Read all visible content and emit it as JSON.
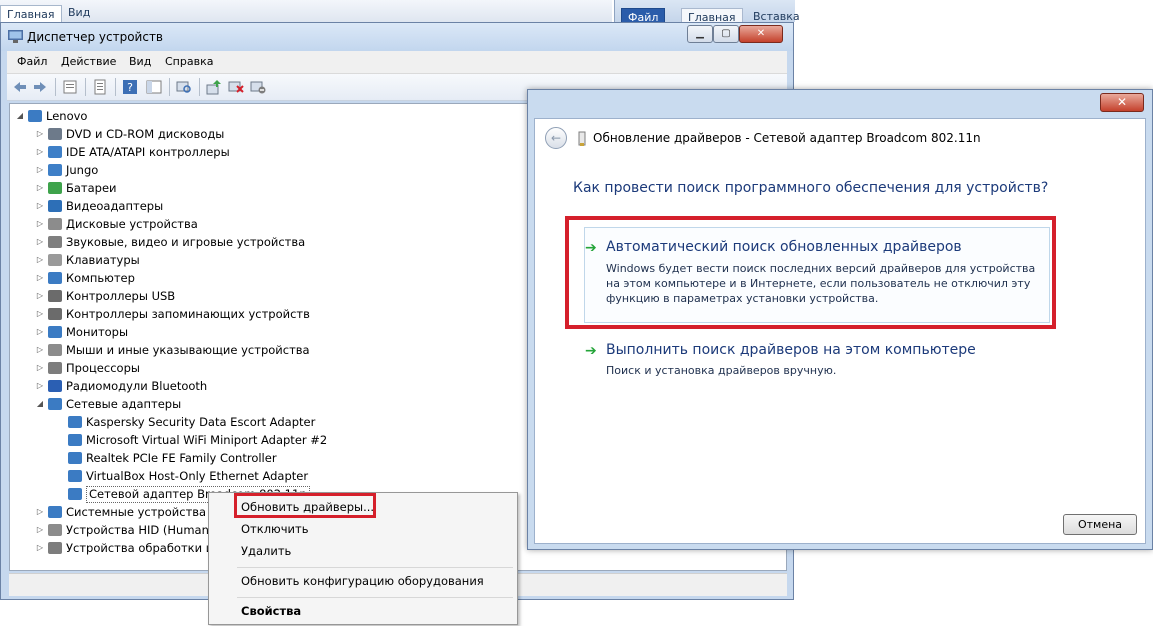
{
  "background_window": {
    "tabs": [
      "Главная",
      "Вид"
    ],
    "right_tabs": [
      "Файл",
      "Главная",
      "Вставка"
    ]
  },
  "device_manager": {
    "title": "Диспетчер устройств",
    "menu": [
      "Файл",
      "Действие",
      "Вид",
      "Справка"
    ],
    "root": "Lenovo",
    "categories": [
      {
        "label": "DVD и CD-ROM дисководы",
        "color": "#6d7a8a"
      },
      {
        "label": "IDE ATA/ATAPI контроллеры",
        "color": "#3e7fc7"
      },
      {
        "label": "Jungo",
        "color": "#3e7fc7"
      },
      {
        "label": "Батареи",
        "color": "#3ea34b"
      },
      {
        "label": "Видеоадаптеры",
        "color": "#2d6fb7"
      },
      {
        "label": "Дисковые устройства",
        "color": "#8c8c8c"
      },
      {
        "label": "Звуковые, видео и игровые устройства",
        "color": "#7f7f7f"
      },
      {
        "label": "Клавиатуры",
        "color": "#9a9a9a"
      },
      {
        "label": "Компьютер",
        "color": "#3b7bc3"
      },
      {
        "label": "Контроллеры USB",
        "color": "#6b6b6b"
      },
      {
        "label": "Контроллеры запоминающих устройств",
        "color": "#6b6b6b"
      },
      {
        "label": "Мониторы",
        "color": "#3b7bc3"
      },
      {
        "label": "Мыши и иные указывающие устройства",
        "color": "#8c8c8c"
      },
      {
        "label": "Процессоры",
        "color": "#7d7d7d"
      },
      {
        "label": "Радиомодули Bluetooth",
        "color": "#2b5fb3"
      },
      {
        "label": "Сетевые адаптеры",
        "color": "#3b7bc3"
      }
    ],
    "network_adapters": [
      "Kaspersky Security Data Escort Adapter",
      "Microsoft Virtual WiFi Miniport Adapter #2",
      "Realtek PCIe FE Family Controller",
      "VirtualBox Host-Only Ethernet Adapter",
      "Сетевой адаптер Broadcom 802.11n"
    ],
    "after_categories": [
      {
        "label": "Системные устройства",
        "color": "#3b7bc3"
      },
      {
        "label": "Устройства HID (Human",
        "color": "#8c8c8c"
      },
      {
        "label": "Устройства обработки из",
        "color": "#7d7d7d"
      }
    ]
  },
  "context_menu": {
    "update": "Обновить драйверы...",
    "disable": "Отключить",
    "remove": "Удалить",
    "scan": "Обновить конфигурацию оборудования",
    "properties": "Свойства"
  },
  "wizard": {
    "title": "Обновление драйверов - Сетевой адаптер Broadcom 802.11n",
    "question": "Как провести поиск программного обеспечения для устройств?",
    "option1_title": "Автоматический поиск обновленных драйверов",
    "option1_desc": "Windows будет вести поиск последних версий драйверов для устройства на этом компьютере и в Интернете, если пользователь не отключил эту функцию в параметрах установки устройства.",
    "option2_title": "Выполнить поиск драйверов на этом компьютере",
    "option2_desc": "Поиск и установка драйверов вручную.",
    "cancel": "Отмена",
    "close_glyph": "✕",
    "back_glyph": "←",
    "arrow_glyph": "➔"
  },
  "colors": {
    "highlight_red": "#d5202b",
    "link_blue": "#1c3a7a",
    "arrow_green": "#25a53a"
  }
}
